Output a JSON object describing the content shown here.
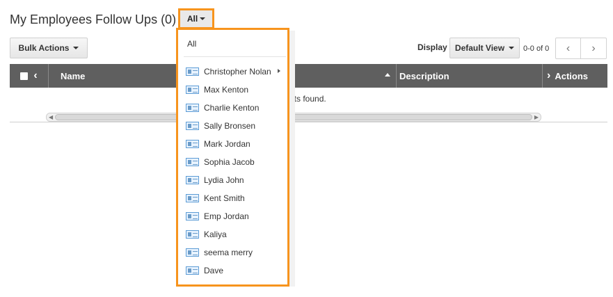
{
  "header": {
    "title": "My Employees Follow Ups (0)",
    "filter_label": "All"
  },
  "toolbar": {
    "bulk_actions_label": "Bulk Actions",
    "display_label": "Display",
    "view_label": "Default View",
    "pager_text": "0-0 of 0"
  },
  "grid": {
    "columns": {
      "name": "Name",
      "description": "Description",
      "actions": "Actions"
    },
    "empty_text": "ects found."
  },
  "dropdown": {
    "all_label": "All",
    "items": [
      "Christopher Nolan",
      "Max Kenton",
      "Charlie Kenton",
      "Sally Bronsen",
      "Mark Jordan",
      "Sophia Jacob",
      "Lydia John",
      "Kent Smith",
      "Emp Jordan",
      "Kaliya",
      "seema merry",
      "Dave"
    ]
  },
  "colors": {
    "highlight": "#f7941d",
    "grid_header": "#5f5f5f"
  }
}
